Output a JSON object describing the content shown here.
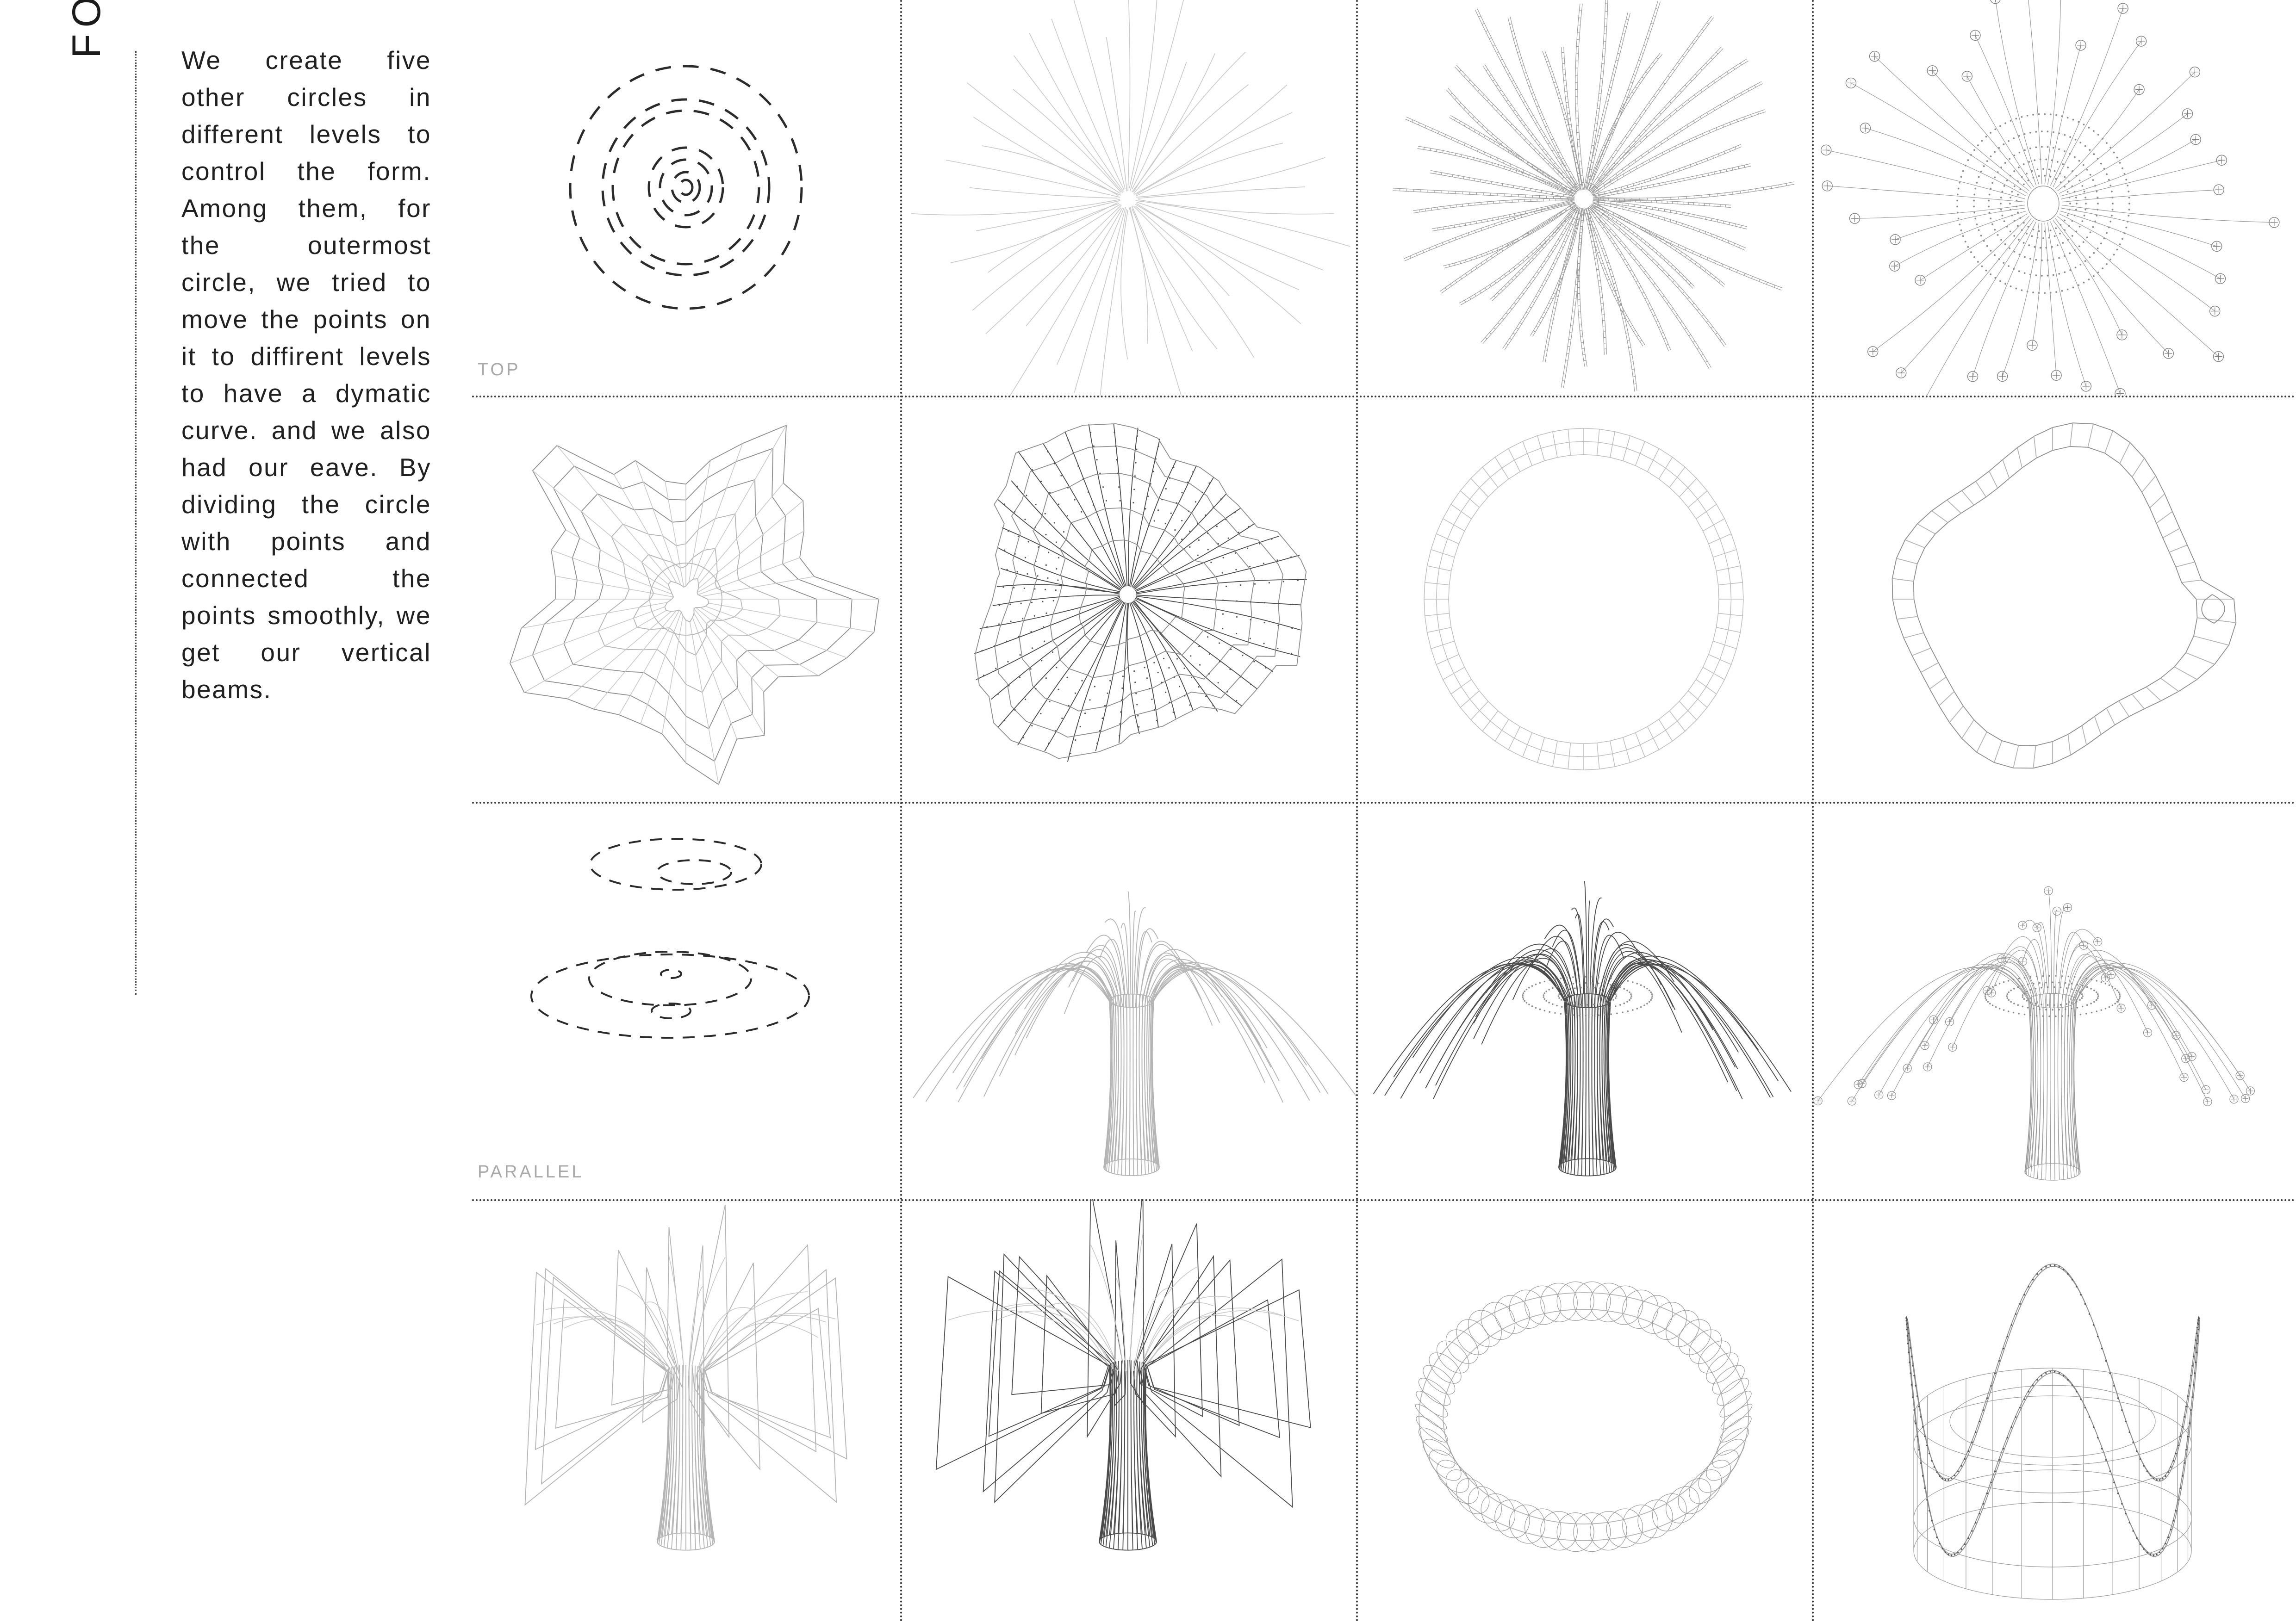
{
  "board": {
    "title": "FORM GENERATION",
    "body_text": "We create five other circles in different levels to control the form. Among them, for the outermost circle, we tried to move the points on it to diffirent levels to have a dymatic curve. and we also had our eave. By dividing the circle with points and connected the points smoothly, we get our vertical beams."
  },
  "labels": {
    "row_top": "TOP",
    "row_parallel": "PARALLEL"
  },
  "colors": {
    "ink": "#1b1b1b",
    "rule": "#3a3a3a",
    "label": "#a9a9a9",
    "line_light": "#b4b4b4",
    "line_mid": "#8e8e8e",
    "line_dark": "#4a4a4a",
    "paper": "#ffffff"
  },
  "matrix": {
    "columns": 4,
    "rows": 4,
    "cells": [
      {
        "id": "r1c1",
        "row": 1,
        "col": 1,
        "view": "TOP",
        "name": "concentric-dashed-circles",
        "description": "Six concentric dashed circles centred on a common point, radii stepping outward.",
        "rings": 6
      },
      {
        "id": "r1c2",
        "row": 1,
        "col": 2,
        "view": "TOP",
        "name": "radial-line-burst",
        "description": "Thin radial lines radiating from a small central void.",
        "rays": 48
      },
      {
        "id": "r1c3",
        "row": 1,
        "col": 3,
        "view": "TOP",
        "name": "segmented-radial-beams",
        "description": "Dense radial beams subdivided into segments by cross ticks.",
        "rays": 48
      },
      {
        "id": "r1c4",
        "row": 1,
        "col": 4,
        "view": "TOP",
        "name": "radial-beams-with-point-markers",
        "description": "Radial beams terminating in crosshair circle markers, inner dotted circles.",
        "rays": 40
      },
      {
        "id": "r2c1",
        "row": 2,
        "col": 1,
        "view": "TOP",
        "name": "organic-contour-rings",
        "description": "Six irregular organic contour rings connected by faint radial spokes.",
        "rings": 6
      },
      {
        "id": "r2c2",
        "row": 2,
        "col": 2,
        "view": "TOP",
        "name": "radial-mesh-web",
        "description": "Radial beams overlaid with quadrilateral mesh web panels.",
        "rays": 48
      },
      {
        "id": "r2c3",
        "row": 2,
        "col": 3,
        "view": "TOP",
        "name": "annular-grid-ring",
        "description": "Circular annulus subdivided into a regular grid of panels.",
        "divisions": 64
      },
      {
        "id": "r2c4",
        "row": 2,
        "col": 4,
        "view": "TOP",
        "name": "organic-annular-ring",
        "description": "Irregular organic annulus with radial ribs and a side bulge.",
        "divisions": 48
      },
      {
        "id": "r3c1",
        "row": 3,
        "col": 1,
        "view": "PARALLEL",
        "name": "stacked-dashed-ellipses",
        "description": "Two levels of dashed ellipses in parallel projection — an upper small pair and a lower large set.",
        "levels": 2
      },
      {
        "id": "r3c2",
        "row": 3,
        "col": 2,
        "view": "PARALLEL",
        "name": "column-with-splayed-beams",
        "description": "Flared column shaft with curving beams splaying outward like a palm.",
        "beams": 40
      },
      {
        "id": "r3c3",
        "row": 3,
        "col": 3,
        "view": "PARALLEL",
        "name": "column-with-segmented-beams",
        "description": "Dark flared column with segmented curving beams and dotted seams.",
        "beams": 40
      },
      {
        "id": "r3c4",
        "row": 3,
        "col": 4,
        "view": "PARALLEL",
        "name": "column-with-marker-beams",
        "description": "Pale column with splayed beams ending in crosshair markers.",
        "beams": 40
      },
      {
        "id": "r4c1",
        "row": 4,
        "col": 1,
        "view": "PARALLEL",
        "name": "canopy-pavilion-light",
        "description": "Column supporting a faceted folded canopy of angular roof panels.",
        "panels": 12
      },
      {
        "id": "r4c2",
        "row": 4,
        "col": 2,
        "view": "PARALLEL",
        "name": "canopy-pavilion-dark",
        "description": "Dark rendering of the canopy pavilion with dense mesh panels.",
        "panels": 12
      },
      {
        "id": "r4c3",
        "row": 4,
        "col": 3,
        "view": "PARALLEL",
        "name": "coiled-torus-ring",
        "description": "Flattened torus of coiled ellipse loops seen in parallel projection.",
        "coils": 60
      },
      {
        "id": "r4c4",
        "row": 4,
        "col": 4,
        "view": "PARALLEL",
        "name": "wavy-crown-drum",
        "description": "Cylindrical wireframe drum crowned by a wavy sinusoidal eave curve.",
        "waves": 4
      }
    ]
  }
}
